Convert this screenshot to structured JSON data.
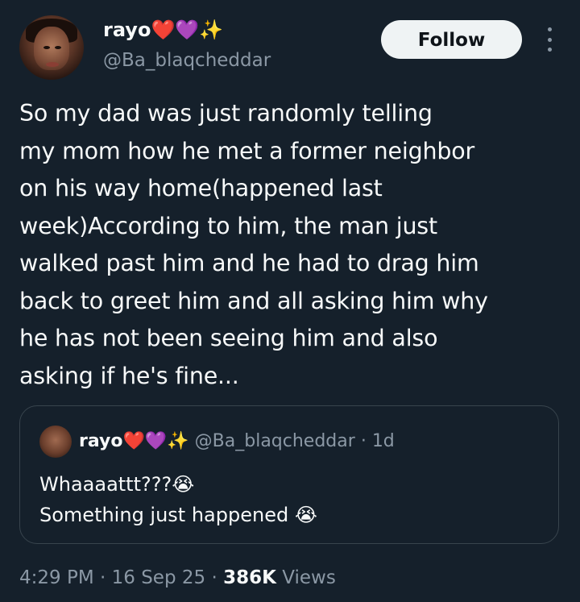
{
  "author": {
    "name": "rayo",
    "emoji": "❤️💜✨",
    "handle": "@Ba_blaqcheddar"
  },
  "actions": {
    "follow_label": "Follow",
    "more_icon": "more-vertical-icon"
  },
  "tweet": {
    "text": "So my dad was just randomly telling\nmy mom how he met a former neighbor\non his way home(happened last\nweek)According to him, the man just\nwalked past him and he had to drag him\nback to greet him and all asking him why\nhe has not been seeing him and also\nasking if he's fine..."
  },
  "quoted_tweet": {
    "name": "rayo",
    "emoji": "❤️💜✨",
    "handle": "@Ba_blaqcheddar",
    "separator": "·",
    "age": "1d",
    "text": "Whaaaattt???😭\nSomething just happened 😭"
  },
  "footer": {
    "time": "4:29 PM",
    "separator1": "·",
    "date": "16 Sep 25",
    "separator2": "·",
    "views_count": "386K",
    "views_label": "Views"
  },
  "colors": {
    "background": "#15202b",
    "text_primary": "#f7f9f9",
    "text_secondary": "#8b98a5",
    "border": "#38444d",
    "button_bg": "#eff3f4"
  }
}
